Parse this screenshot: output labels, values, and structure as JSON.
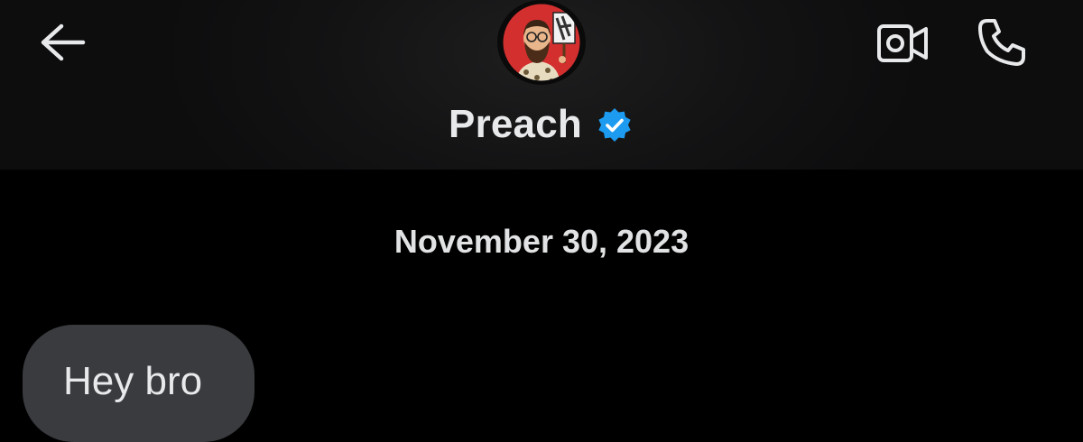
{
  "header": {
    "contact_name": "Preach",
    "verified": true,
    "verified_color": "#1d9bf0",
    "back_icon": "arrow-left-icon",
    "video_icon": "video-camera-icon",
    "call_icon": "phone-icon"
  },
  "conversation": {
    "date_separator": "November 30, 2023",
    "messages": [
      {
        "direction": "incoming",
        "text": "Hey bro"
      }
    ]
  },
  "colors": {
    "background": "#000000",
    "incoming_bubble": "#393b3f",
    "text": "#e7e9ea"
  }
}
